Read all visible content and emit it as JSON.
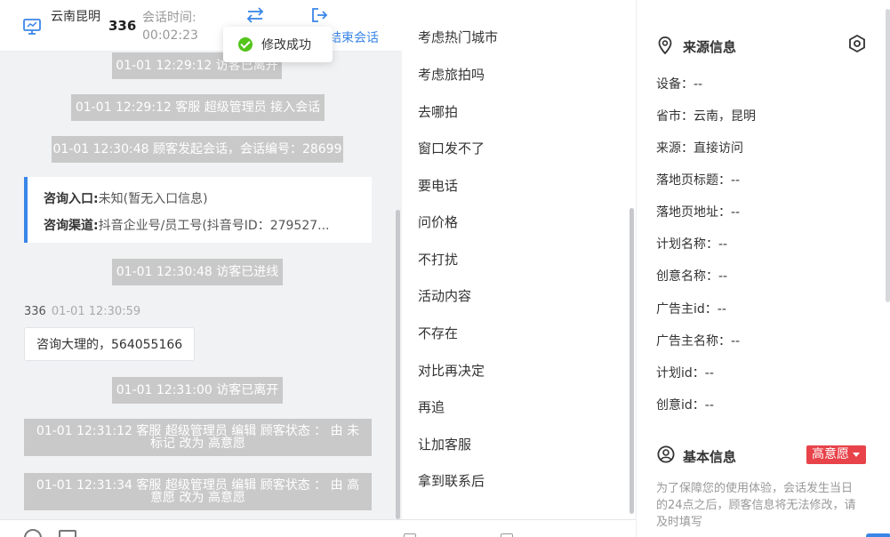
{
  "header": {
    "visitor_location": "云南昆明",
    "visitor_id": "336",
    "session_time_label": "会话时间:",
    "session_time_value": "00:02:23",
    "end_session_label": "结束会话",
    "toast": "修改成功"
  },
  "chat": {
    "messages": [
      "01-01 12:29:12 访客已离开",
      "01-01 12:29:12 客服 超级管理员 接入会话",
      "01-01 12:30:48 顾客发起会话，会话编号：28699",
      "01-01 12:30:48 访客已进线",
      "01-01 12:31:00 访客已离开",
      "01-01 12:31:12 客服 超级管理员 编辑 顾客状态 ： 由 未标记 改为 高意愿",
      "01-01 12:31:34 客服 超级管理员 编辑 顾客状态 ： 由 高意愿 改为 高意愿"
    ],
    "entry_card": {
      "entry_label": "咨询入口:",
      "entry_value": "未知(暂无入口信息)",
      "channel_label": "咨询渠道:",
      "channel_value": "抖音企业号/员工号(抖音号ID：279527..."
    },
    "customer_name": "336",
    "customer_time": "01-01 12:30:59",
    "customer_message": "咨询大理的，564055166"
  },
  "tags": [
    "考虑热门城市",
    "考虑旅拍吗",
    "去哪拍",
    "窗口发不了",
    "要电话",
    "问价格",
    "不打扰",
    "活动内容",
    "不存在",
    "对比再决定",
    "再追",
    "让加客服",
    "拿到联系后"
  ],
  "source_info": {
    "title": "来源信息",
    "fields": [
      "设备：--",
      "省市：云南，昆明",
      "来源：直接访问",
      "落地页标题：--",
      "落地页地址：--",
      "计划名称：--",
      "创意名称：--",
      "广告主id：--",
      "广告主名称：--",
      "计划id：--",
      "创意id：--"
    ]
  },
  "basic_info": {
    "title": "基本信息",
    "intent_badge": "高意愿",
    "notice": "为了保障您的使用体验，会话发生当日的24点之后，顾客信息将无法修改，请及时填写"
  },
  "colors": {
    "accent": "#3a86e8",
    "system_message_bg": "#c9c9c9",
    "badge_red": "#e8434a",
    "success_green": "#52c41a"
  }
}
